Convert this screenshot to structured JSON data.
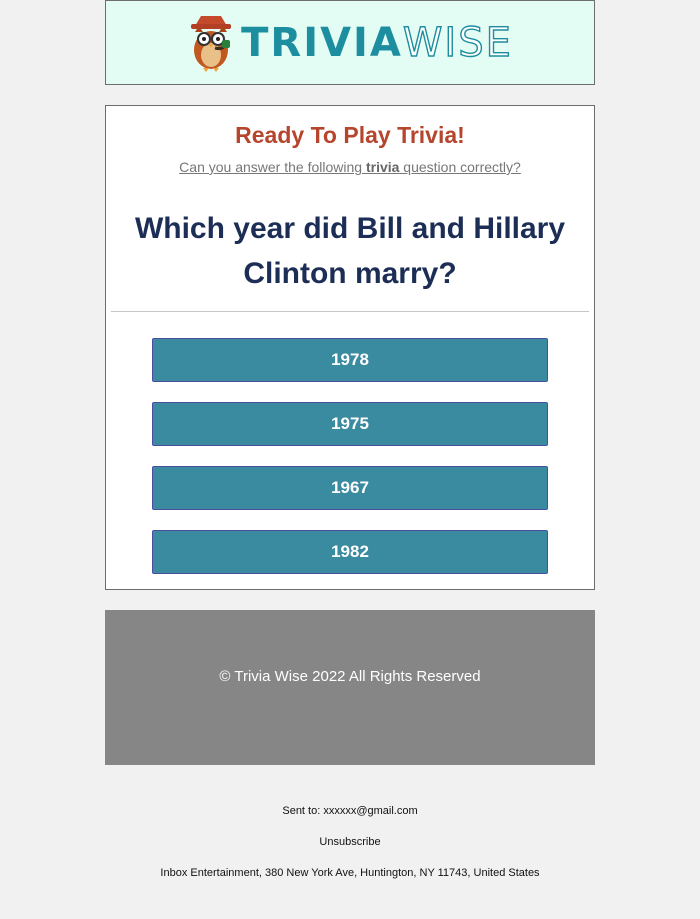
{
  "header": {
    "logo_text_strong": "TRIVIA",
    "logo_text_light": "WISE"
  },
  "card": {
    "heading": "Ready To Play Trivia!",
    "subline_before": "Can you answer the following ",
    "subline_bold": "trivia",
    "subline_after": " question correctly?",
    "question": "Which year did Bill and Hillary Clinton marry?",
    "answers": [
      {
        "label": "1978"
      },
      {
        "label": "1975"
      },
      {
        "label": "1967"
      },
      {
        "label": "1982"
      }
    ]
  },
  "footer": {
    "copyright": "© Trivia Wise 2022 All Rights Reserved"
  },
  "fine_print": {
    "sent_to_label": "Sent to: ",
    "sent_to_email": "xxxxxx@gmail.com",
    "unsubscribe": "Unsubscribe",
    "address": "Inbox Entertainment, 380 New York Ave, Huntington, NY 11743, United States"
  },
  "colors": {
    "heading": "#b5462d",
    "question": "#1c2e55",
    "answer_bg": "#3a8ba0",
    "footer_bg": "#858685",
    "header_bg": "#e3fdf5",
    "logo": "#1d8ea0"
  },
  "icons": {
    "logo_mascot": "owl-mascot-icon"
  }
}
